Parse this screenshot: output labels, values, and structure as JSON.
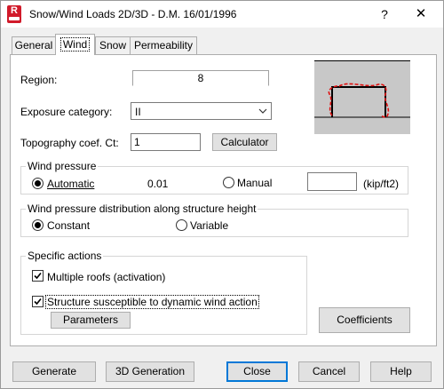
{
  "window": {
    "title": "Snow/Wind Loads 2D/3D - D.M. 16/01/1996",
    "help_glyph": "?",
    "close_glyph": "✕",
    "app_icon": "R"
  },
  "tabs": [
    {
      "label": "General",
      "active": false
    },
    {
      "label": "Wind",
      "active": true
    },
    {
      "label": "Snow",
      "active": false
    },
    {
      "label": "Permeability",
      "active": false
    }
  ],
  "wind": {
    "region_label": "Region:",
    "region_value": "8",
    "exposure_label": "Exposure category:",
    "exposure_value": "II",
    "topo_label": "Topography coef. Ct:",
    "topo_value": "1",
    "calculator_label": "Calculator",
    "pressure_group": {
      "title": "Wind pressure",
      "automatic_label": "Automatic",
      "automatic_selected": true,
      "auto_value": "0.01",
      "manual_label": "Manual",
      "manual_value": "",
      "unit": "(kip/ft2)"
    },
    "distribution_group": {
      "title": "Wind pressure distribution along structure height",
      "constant_label": "Constant",
      "constant_selected": true,
      "variable_label": "Variable"
    },
    "actions_group": {
      "title": "Specific actions",
      "multiple_roofs_label": "Multiple roofs (activation)",
      "multiple_roofs_checked": true,
      "dynamic_label": "Structure susceptible to dynamic wind action",
      "dynamic_checked": true,
      "parameters_label": "Parameters"
    },
    "coefficients_label": "Coefficients"
  },
  "footer": {
    "generate": "Generate",
    "generation_3d": "3D Generation",
    "close": "Close",
    "cancel": "Cancel",
    "help": "Help"
  },
  "colors": {
    "accent": "#0078d7",
    "brand": "#d11a2a",
    "preview_bg": "#c8c8c8",
    "deformed": "#e01010"
  }
}
